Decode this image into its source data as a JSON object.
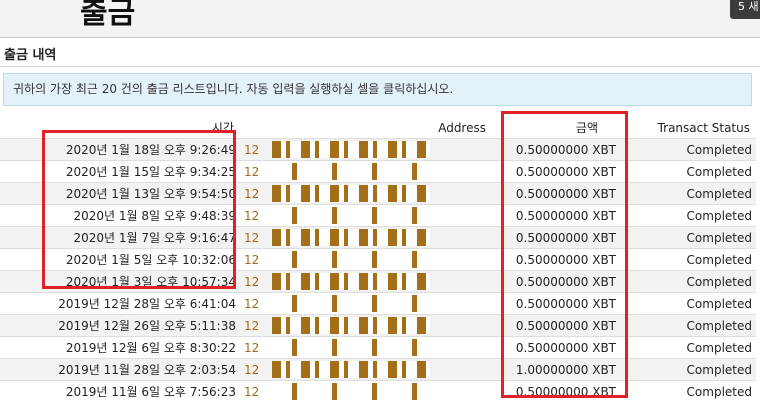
{
  "header": {
    "title": "출금",
    "corner_tab_label": "5 새"
  },
  "section": {
    "title": "출금 내역",
    "info": "귀하의 가장 최근 20 건의 출금 리스트입니다. 자동 입력을 실행하실 셀을 클릭하십시오."
  },
  "table": {
    "columns": {
      "time": "시간",
      "address": "Address",
      "amount": "금액",
      "status": "Transact Status"
    },
    "rows": [
      {
        "time": "2020년 1월 18일 오후 9:26:49",
        "address_prefix": "12",
        "amount": "0.50000000 XBT",
        "status": "Completed"
      },
      {
        "time": "2020년 1월 15일 오후 9:34:25",
        "address_prefix": "12",
        "amount": "0.50000000 XBT",
        "status": "Completed"
      },
      {
        "time": "2020년 1월 13일 오후 9:54:50",
        "address_prefix": "12",
        "amount": "0.50000000 XBT",
        "status": "Completed"
      },
      {
        "time": "2020년 1월 8일 오후 9:48:39",
        "address_prefix": "12",
        "amount": "0.50000000 XBT",
        "status": "Completed"
      },
      {
        "time": "2020년 1월 7일 오후 9:16:47",
        "address_prefix": "12",
        "amount": "0.50000000 XBT",
        "status": "Completed"
      },
      {
        "time": "2020년 1월 5일 오후 10:32:06",
        "address_prefix": "12",
        "amount": "0.50000000 XBT",
        "status": "Completed"
      },
      {
        "time": "2020년 1월 3일 오후 10:57:34",
        "address_prefix": "12",
        "amount": "0.50000000 XBT",
        "status": "Completed"
      },
      {
        "time": "2019년 12월 28일 오후 6:41:04",
        "address_prefix": "12",
        "amount": "0.50000000 XBT",
        "status": "Completed"
      },
      {
        "time": "2019년 12월 26일 오후 5:11:38",
        "address_prefix": "12",
        "amount": "0.50000000 XBT",
        "status": "Completed"
      },
      {
        "time": "2019년 12월 6일 오후 8:30:22",
        "address_prefix": "12",
        "amount": "0.50000000 XBT",
        "status": "Completed"
      },
      {
        "time": "2019년 11월 28일 오후 2:03:54",
        "address_prefix": "12",
        "amount": "1.00000000 XBT",
        "status": "Completed"
      },
      {
        "time": "2019년 11월 6일 오후 7:56:23",
        "address_prefix": "12",
        "amount": "0.50000000 XBT",
        "status": "Completed"
      }
    ]
  },
  "colors": {
    "highlight": "#e02228",
    "info_bg": "#e3f1f8",
    "redaction": "#9a6000"
  }
}
